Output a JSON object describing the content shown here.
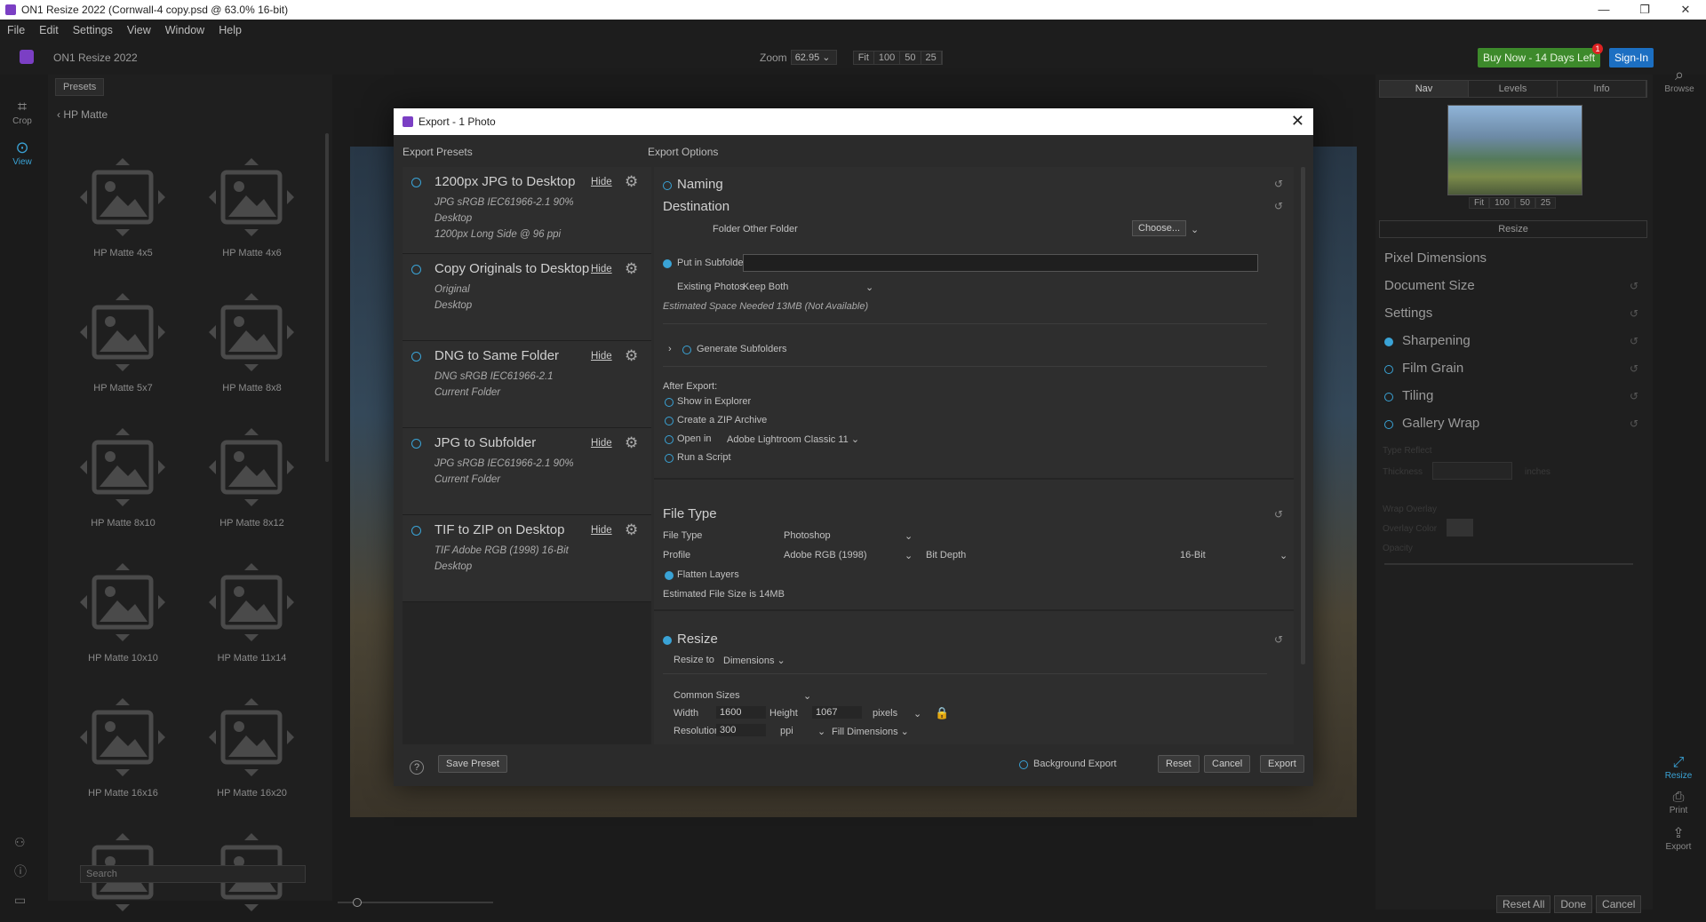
{
  "window": {
    "title": "ON1 Resize 2022 (Cornwall-4 copy.psd @ 63.0% 16-bit)",
    "controls": [
      "—",
      "❐",
      "✕"
    ]
  },
  "menu": [
    "File",
    "Edit",
    "Settings",
    "View",
    "Window",
    "Help"
  ],
  "toolbar": {
    "app_name": "ON1 Resize 2022",
    "zoom_label": "Zoom",
    "zoom_value": "62.95",
    "zoom_buttons": [
      "Fit",
      "100",
      "50",
      "25"
    ],
    "buy_label": "Buy Now - 14 Days Left",
    "badge": "1",
    "signin_label": "Sign-In",
    "browse_label": "Browse"
  },
  "rail": {
    "crop": "Crop",
    "view": "View"
  },
  "presets_panel": {
    "tab": "Presets",
    "back": "HP Matte",
    "search_placeholder": "Search",
    "items": [
      "HP Matte 4x5",
      "HP Matte 4x6",
      "HP Matte 5x7",
      "HP Matte 8x8",
      "HP Matte 8x10",
      "HP Matte 8x12",
      "HP Matte 10x10",
      "HP Matte 11x14",
      "HP Matte 16x16",
      "HP Matte 16x20",
      "",
      ""
    ]
  },
  "right_panel": {
    "tabs": [
      "Nav",
      "Levels",
      "Info"
    ],
    "nav_zoom": [
      "Fit",
      "100",
      "50",
      "25"
    ],
    "resize": "Resize",
    "sections": [
      "Pixel Dimensions",
      "Document Size",
      "Settings"
    ],
    "checks": [
      {
        "label": "Sharpening",
        "on": true
      },
      {
        "label": "Film Grain",
        "on": false
      },
      {
        "label": "Tiling",
        "on": false
      },
      {
        "label": "Gallery Wrap",
        "on": false
      }
    ],
    "dim": {
      "type_reflect": "Type  Reflect",
      "thickness": "Thickness",
      "inches": "inches",
      "wrap_overlay": "Wrap Overlay",
      "overlay_color": "Overlay Color",
      "opacity": "Opacity"
    }
  },
  "right_rail": {
    "resize": "Resize",
    "print": "Print",
    "export": "Export"
  },
  "footer": {
    "reset_all": "Reset All",
    "done": "Done",
    "cancel": "Cancel"
  },
  "dialog": {
    "title": "Export - 1 Photo",
    "presets_head": "Export Presets",
    "options_head": "Export Options",
    "hide": "Hide",
    "presets": [
      {
        "name": "1200px JPG to Desktop",
        "lines": [
          "JPG  sRGB IEC61966-2.1  90%",
          "Desktop",
          "1200px Long Side @ 96 ppi"
        ]
      },
      {
        "name": "Copy Originals to Desktop",
        "lines": [
          "Original",
          "Desktop"
        ]
      },
      {
        "name": "DNG to Same Folder",
        "lines": [
          "DNG  sRGB IEC61966-2.1",
          "Current Folder"
        ]
      },
      {
        "name": "JPG to Subfolder",
        "lines": [
          "JPG  sRGB IEC61966-2.1  90%",
          "Current Folder"
        ]
      },
      {
        "name": "TIF to ZIP on Desktop",
        "lines": [
          "TIF  Adobe RGB (1998)  16-Bit",
          "Desktop"
        ]
      }
    ],
    "naming": "Naming",
    "destination": {
      "title": "Destination",
      "folder_label": "Folder",
      "folder_value": "Other Folder",
      "choose": "Choose...",
      "subfolder": "Put in Subfolder",
      "existing_label": "Existing Photos",
      "existing_value": "Keep Both",
      "space": "Estimated Space Needed 13MB (Not Available)",
      "generate": "Generate Subfolders",
      "after_export": "After Export:",
      "show_explorer": "Show in Explorer",
      "zip": "Create a ZIP Archive",
      "open_in": "Open in",
      "open_app": "Adobe Lightroom Classic 11",
      "script": "Run a Script"
    },
    "filetype": {
      "title": "File Type",
      "type_label": "File Type",
      "type_value": "Photoshop",
      "profile_label": "Profile",
      "profile_value": "Adobe RGB (1998)",
      "depth_label": "Bit Depth",
      "depth_value": "16-Bit",
      "flatten": "Flatten Layers",
      "size": "Estimated File Size is 14MB"
    },
    "resize": {
      "title": "Resize",
      "resize_to_label": "Resize to",
      "resize_to_value": "Dimensions",
      "common": "Common Sizes",
      "width_label": "Width",
      "width_value": "1600",
      "height_label": "Height",
      "height_value": "1067",
      "unit": "pixels",
      "res_label": "Resolution",
      "res_value": "300",
      "res_unit": "ppi",
      "fill": "Fill Dimensions"
    },
    "footer": {
      "help": "?",
      "save_preset": "Save Preset",
      "background_export": "Background Export",
      "reset": "Reset",
      "cancel": "Cancel",
      "export": "Export"
    }
  }
}
